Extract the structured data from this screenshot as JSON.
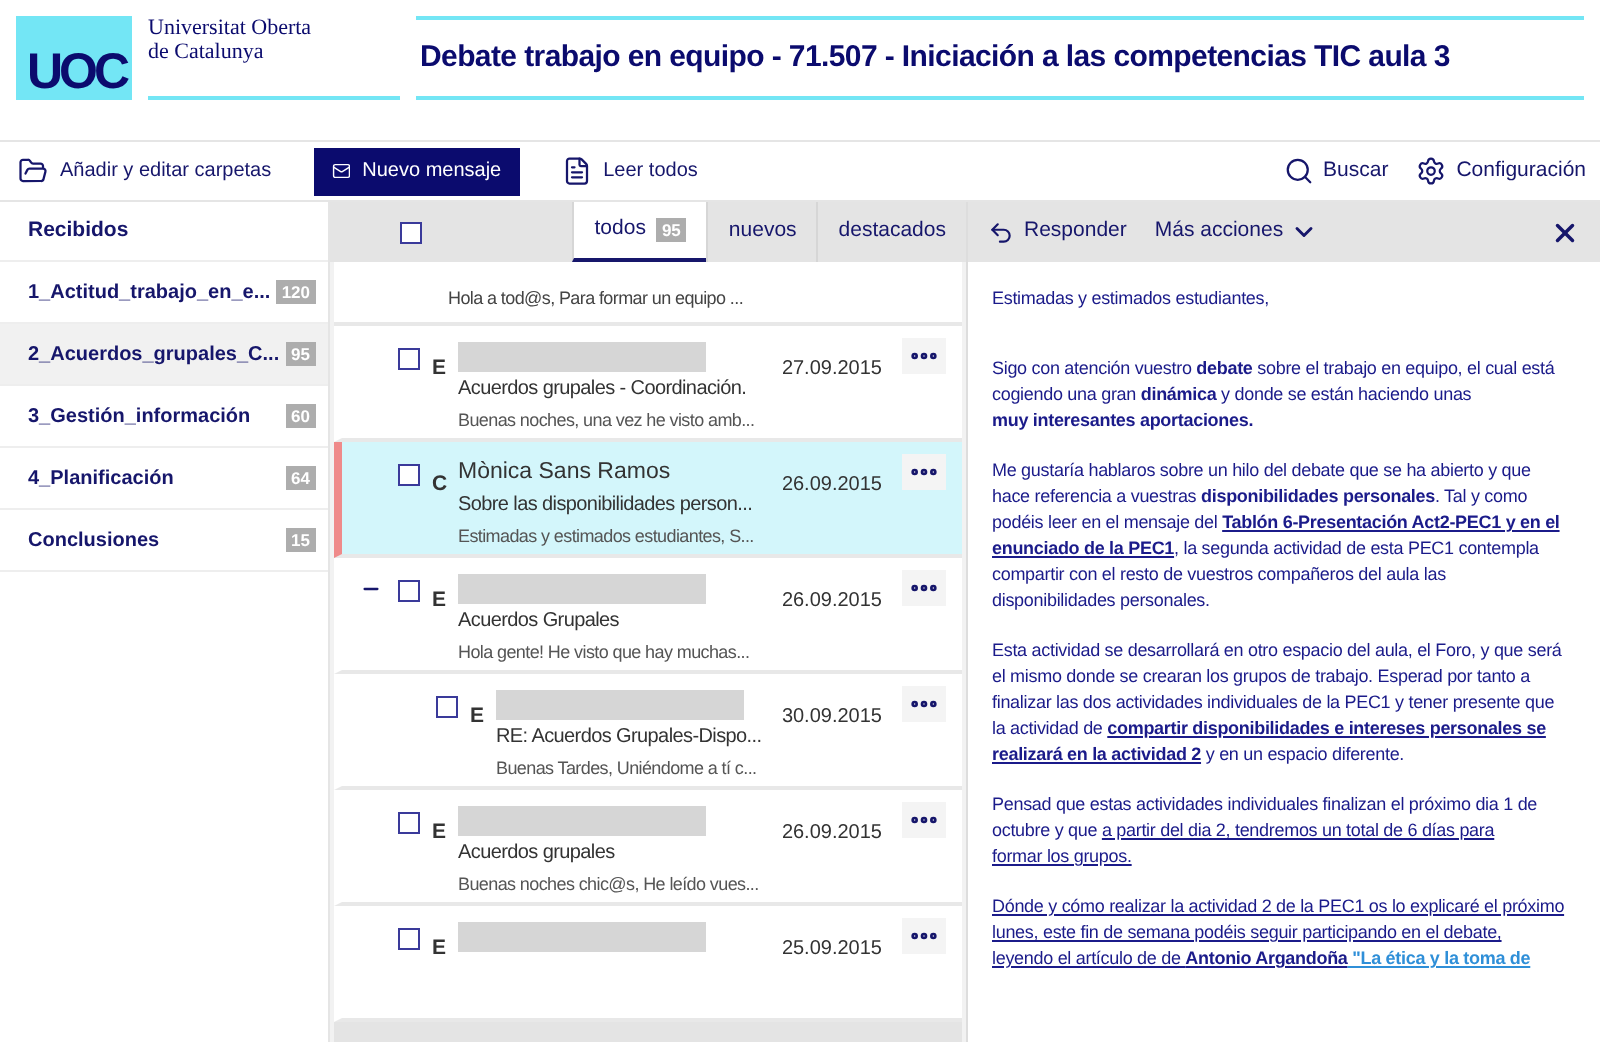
{
  "header": {
    "logo_text": "UOC",
    "university": [
      "Universitat Oberta",
      "de Catalunya"
    ],
    "title": "Debate trabajo en equipo - 71.507 - Iniciación a las competencias TIC aula 3"
  },
  "toolbar": {
    "left": [
      {
        "kind": "folder",
        "label": "Añadir y editar carpetas"
      },
      {
        "kind": "compose",
        "label": "Nuevo mensaje"
      },
      {
        "kind": "read",
        "label": "Leer todos"
      }
    ],
    "right": [
      {
        "kind": "search",
        "label": "Buscar"
      },
      {
        "kind": "settings",
        "label": "Configuración"
      }
    ]
  },
  "sidebar": {
    "header": "Recibidos",
    "folders": [
      {
        "name": "1_Actitud_trabajo_en_e...",
        "count": "120",
        "selected": false
      },
      {
        "name": "2_Acuerdos_grupales_C...",
        "count": "95",
        "selected": true
      },
      {
        "name": "3_Gestión_información",
        "count": "60",
        "selected": false
      },
      {
        "name": "4_Planificación",
        "count": "64",
        "selected": false
      },
      {
        "name": "Conclusiones",
        "count": "15",
        "selected": false
      }
    ]
  },
  "list": {
    "select_all": {
      "checked": false
    },
    "tabs": [
      {
        "label": "todos",
        "count": "95",
        "selected": true
      },
      {
        "label": "nuevos",
        "selected": false
      },
      {
        "label": "destacados",
        "selected": false
      }
    ],
    "messages": [
      {
        "kind": "partial",
        "preview": "Hola a tod@s, Para formar un equipo ..."
      },
      {
        "kind": "message",
        "checked": false,
        "letter": "E",
        "date": "27.09.2015",
        "subject": "Acuerdos grupales - Coordinación.",
        "preview": "Buenas noches, una vez he visto amb...",
        "selected": false
      },
      {
        "kind": "message",
        "checked": false,
        "letter": "C",
        "sender": "Mònica Sans Ramos",
        "date": "26.09.2015",
        "subject": "Sobre las disponibilidades person...",
        "preview": "Estimadas y estimados estudiantes, S...",
        "selected": true
      },
      {
        "kind": "message",
        "checked": false,
        "letter": "E",
        "date": "26.09.2015",
        "subject": "Acuerdos Grupales",
        "preview": "Hola gente! He visto que hay muchas...",
        "selected": false,
        "expanded": true,
        "children": [
          {
            "kind": "message",
            "checked": false,
            "letter": "E",
            "date": "30.09.2015",
            "subject": "RE: Acuerdos Grupales-Dispo...",
            "preview": "Buenas Tardes, Uniéndome a tí c...",
            "selected": false
          }
        ]
      },
      {
        "kind": "message",
        "checked": false,
        "letter": "E",
        "date": "26.09.2015",
        "subject": "Acuerdos grupales",
        "preview": "Buenas noches chic@s, He leído vues...",
        "selected": false
      },
      {
        "kind": "message",
        "checked": false,
        "letter": "E",
        "date": "25.09.2015",
        "selected": false
      }
    ]
  },
  "reader": {
    "reply": "Responder",
    "more_actions": "Más acciones",
    "paragraphs": [
      {
        "lines": [
          [
            {
              "kind": "text",
              "text": "Estimadas y estimados estudiantes,"
            }
          ]
        ]
      },
      {
        "lines": [
          [
            {
              "kind": "text",
              "text": "Sigo con atención vuestro **debate** sobre el trabajo en equipo, el cual está"
            }
          ],
          [
            {
              "kind": "text",
              "text": "cogiendo una gran **dinámica** y donde se están haciendo unas"
            }
          ],
          [
            {
              "kind": "text",
              "text": "**muy interesantes aportaciones.**"
            }
          ]
        ]
      },
      {
        "lines": [
          [
            {
              "kind": "text",
              "text": "Me gustaría hablaros sobre un hilo del debate que se ha abierto y que"
            }
          ],
          [
            {
              "kind": "text",
              "text": "hace referencia a vuestras **disponibilidades personales**. Tal y como"
            }
          ],
          [
            {
              "kind": "text",
              "text": "podéis leer en el mensaje del "
            },
            {
              "kind": "link",
              "text": "Tablón 6-Presentación Act2-PEC1 y en el"
            }
          ],
          [
            {
              "kind": "link",
              "text": "enunciado de la PEC1"
            },
            {
              "kind": "text",
              "text": ", la segunda actividad de esta PEC1 contempla"
            }
          ],
          [
            {
              "kind": "text",
              "text": "compartir con el resto de vuestros compañeros del aula las"
            }
          ],
          [
            {
              "kind": "text",
              "text": "disponibilidades personales."
            }
          ]
        ]
      },
      {
        "lines": [
          [
            {
              "kind": "text",
              "text": "Esta actividad se desarrollará en otro espacio del aula, el Foro, y que será"
            }
          ],
          [
            {
              "kind": "text",
              "text": "el mismo donde se crearan los grupos de trabajo. Esperad por tanto a"
            }
          ],
          [
            {
              "kind": "text",
              "text": "finalizar las dos actividades individuales de la PEC1 y tener presente que"
            }
          ],
          [
            {
              "kind": "text",
              "text": "la actividad de "
            },
            {
              "kind": "link",
              "text": "compartir disponibilidades e intereses personales se"
            }
          ],
          [
            {
              "kind": "link",
              "text": "realizará en la actividad 2"
            },
            {
              "kind": "text",
              "text": " y en un espacio diferente."
            }
          ]
        ]
      },
      {
        "lines": [
          [
            {
              "kind": "text",
              "text": "Pensad que estas actividades individuales finalizan el próximo dia 1 de"
            }
          ],
          [
            {
              "kind": "text",
              "text": "octubre y que "
            },
            {
              "kind": "underline",
              "text": "a partir del dia 2, tendremos un total de 6 días para"
            }
          ],
          [
            {
              "kind": "underline",
              "text": "formar los grupos."
            }
          ]
        ]
      },
      {
        "lines": [
          [
            {
              "kind": "underline",
              "text": "Dónde y cómo realizar la actividad 2 de la PEC1 os lo explicaré el próximo"
            }
          ],
          [
            {
              "kind": "underline",
              "text": "lunes, este fin de semana podéis seguir participando en el debate,"
            }
          ],
          [
            {
              "kind": "underline",
              "text": "leyendo el artículo de de "
            },
            {
              "kind": "link",
              "text": "Antonio Argandoña"
            },
            {
              "kind": "highlight_link",
              "text": " \"La ética y la toma de"
            }
          ]
        ]
      }
    ]
  }
}
